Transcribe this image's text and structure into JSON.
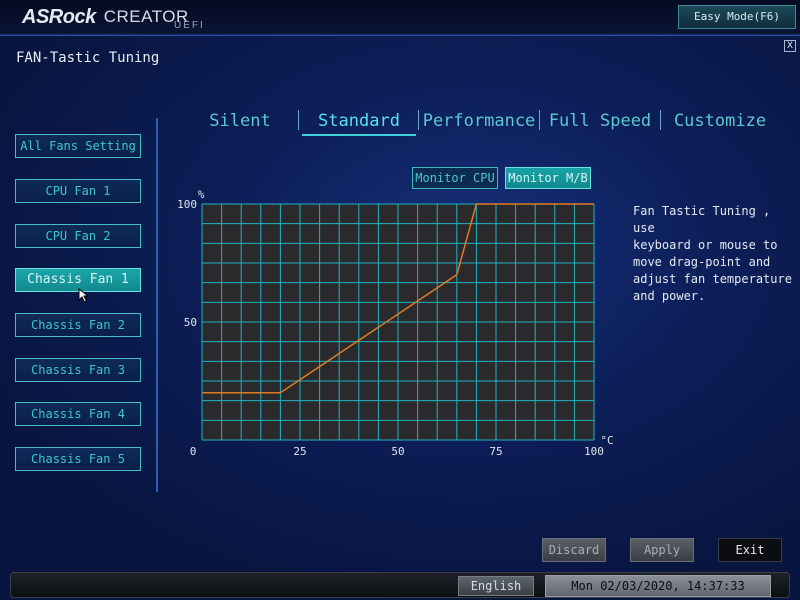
{
  "brand": {
    "name": "ASRock",
    "product": "CREATOR",
    "suffix": "UEFI"
  },
  "header": {
    "easy_mode_label": "Easy Mode(F6)",
    "close_label": "X"
  },
  "page_title": "FAN-Tastic Tuning",
  "fans": [
    {
      "label": "All Fans Setting",
      "active": false
    },
    {
      "label": "CPU Fan 1",
      "active": false
    },
    {
      "label": "CPU Fan 2",
      "active": false
    },
    {
      "label": "Chassis Fan 1",
      "active": true
    },
    {
      "label": "Chassis Fan 2",
      "active": false
    },
    {
      "label": "Chassis Fan 3",
      "active": false
    },
    {
      "label": "Chassis Fan 4",
      "active": false
    },
    {
      "label": "Chassis Fan 5",
      "active": false
    }
  ],
  "modes": [
    {
      "label": "Silent",
      "active": false
    },
    {
      "label": "Standard",
      "active": true
    },
    {
      "label": "Performance",
      "active": false
    },
    {
      "label": "Full Speed",
      "active": false
    },
    {
      "label": "Customize",
      "active": false
    }
  ],
  "monitor": [
    {
      "label": "Monitor CPU",
      "active": false
    },
    {
      "label": "Monitor M/B",
      "active": true
    }
  ],
  "chart_data": {
    "type": "line",
    "series": [
      {
        "x": [
          0,
          20,
          65,
          70,
          100
        ],
        "y": [
          20,
          20,
          70,
          100,
          100
        ]
      }
    ],
    "x_ticks": [
      "0",
      "25",
      "50",
      "75",
      "100"
    ],
    "y_ticks": [
      "100",
      "50"
    ],
    "xlabel": "°C",
    "ylabel": "%",
    "xlim": [
      0,
      100
    ],
    "ylim": [
      0,
      100
    ],
    "grid": true,
    "line_color": "#e07a22",
    "grid_color": "#1fb3c2"
  },
  "help_text": "Fan Tastic Tuning , use\nkeyboard or mouse to\nmove drag-point and\nadjust fan temperature\nand power.",
  "actions": {
    "discard_label": "Discard",
    "apply_label": "Apply",
    "exit_label": "Exit"
  },
  "status": {
    "language_label": "English",
    "datetime": "Mon 02/03/2020, 14:37:33"
  }
}
